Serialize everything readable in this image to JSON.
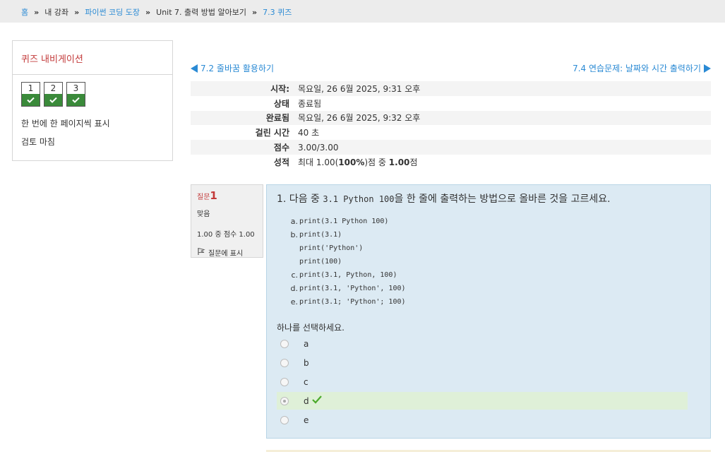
{
  "breadcrumb": [
    {
      "label": "홈",
      "link": true
    },
    {
      "label": "내 강좌",
      "link": false
    },
    {
      "label": "파이썬 코딩 도장",
      "link": true
    },
    {
      "label": "Unit 7. 출력 방법 알아보기",
      "link": false
    },
    {
      "label": "7.3 퀴즈",
      "link": true
    }
  ],
  "quiz_nav": {
    "title": "퀴즈 내비게이션",
    "buttons": [
      "1",
      "2",
      "3"
    ],
    "show_one_page": "한 번에 한 페이지씩 표시",
    "finish_review": "검토 마침"
  },
  "prev_link": "7.2 줄바꿈 활용하기",
  "next_link": "7.4 연습문제: 날짜와 시간 출력하기",
  "summary": {
    "rows": [
      {
        "key": "시작:",
        "value": "목요일, 26 6월 2025, 9:31 오후"
      },
      {
        "key": "상태",
        "value": "종료됨"
      },
      {
        "key": "완료됨",
        "value": "목요일, 26 6월 2025, 9:32 오후"
      },
      {
        "key": "걸린 시간",
        "value": "40 초"
      },
      {
        "key": "점수",
        "value": "3.00/3.00"
      }
    ],
    "grade_key": "성적",
    "grade_prefix": "최대 1.00(",
    "grade_percent": "100%",
    "grade_mid": ")점 중 ",
    "grade_score": "1.00",
    "grade_suffix": "점"
  },
  "question": {
    "label": "질문",
    "number": "1",
    "state": "맞음",
    "mark": "1.00 중 점수 1.00",
    "flag_label": "질문에 표시",
    "text_pre": "1. 다음 중 ",
    "text_code": "3.1 Python 100",
    "text_post": "을 한 줄에 출력하는 방법으로 올바른 것을 고르세요.",
    "answers": [
      {
        "label": "a.",
        "lines": [
          "print(3.1 Python 100)"
        ]
      },
      {
        "label": "b.",
        "lines": [
          "print(3.1)",
          "print('Python')",
          "print(100)"
        ]
      },
      {
        "label": "c.",
        "lines": [
          "print(3.1, Python, 100)"
        ]
      },
      {
        "label": "d.",
        "lines": [
          "print(3.1, 'Python', 100)"
        ]
      },
      {
        "label": "e.",
        "lines": [
          "print(3.1; 'Python'; 100)"
        ]
      }
    ],
    "prompt": "하나를 선택하세요.",
    "choices": [
      "a",
      "b",
      "c",
      "d",
      "e"
    ],
    "selected": "d",
    "correct_color": "#dff0d8"
  },
  "colors": {
    "accent_link": "#2a8ad4",
    "heading_red": "#c33a3a",
    "nav_check_green": "#3a8a3a",
    "question_bg": "#dceaf3"
  }
}
